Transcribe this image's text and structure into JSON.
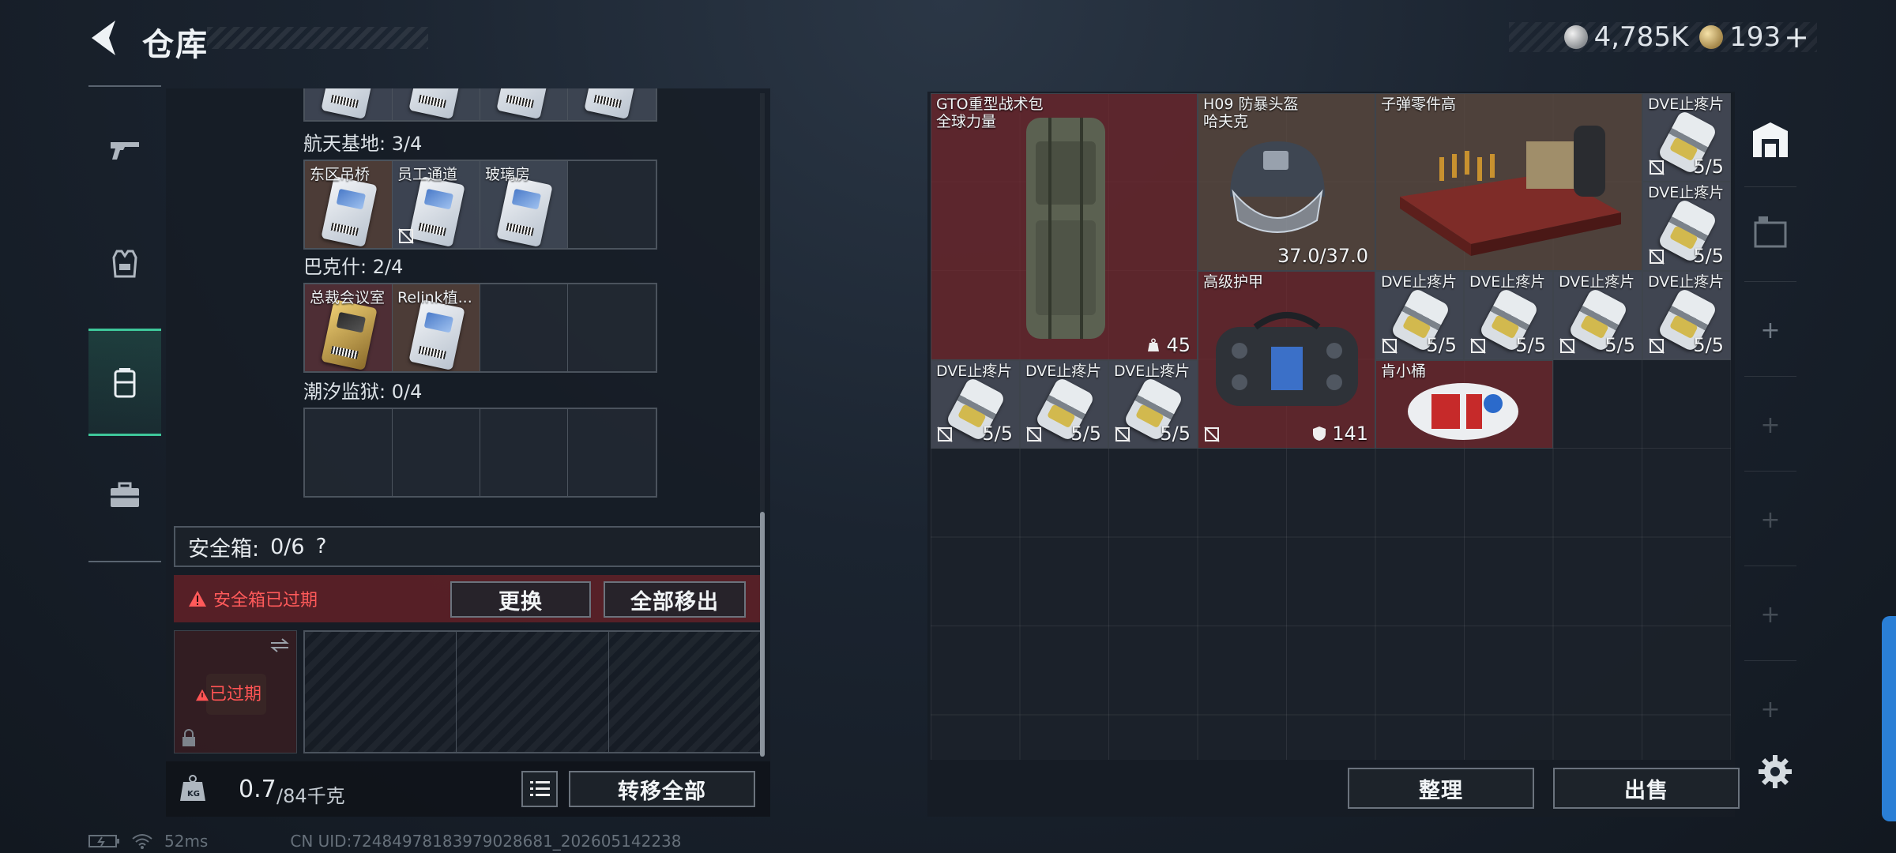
{
  "header": {
    "title": "仓库"
  },
  "currency": {
    "silver_amount": "4,785K",
    "gold_amount": "193",
    "plus": "+"
  },
  "left": {
    "sections": [
      {
        "label": "航天基地: 3/4",
        "cells": [
          "东区吊桥",
          "员工通道",
          "玻璃房",
          ""
        ]
      },
      {
        "label": "巴克什: 2/4",
        "cells": [
          "总裁会议室",
          "Relink植...",
          "",
          ""
        ]
      },
      {
        "label": "潮汐监狱: 0/4",
        "cells": [
          "",
          "",
          "",
          ""
        ]
      }
    ],
    "safe_box": {
      "label": "安全箱:",
      "count": "0/6",
      "help": "?"
    },
    "expired_warning": "安全箱已过期",
    "replace_button": "更换",
    "remove_all_button": "全部移出",
    "slot_expired": "已过期",
    "weight": {
      "current": "0.7",
      "max": "/84千克"
    },
    "transfer_all_button": "转移全部"
  },
  "stash": {
    "items": [
      {
        "name": "GTO重型战术包\n全球力量",
        "stat": "45",
        "icon": "backpack",
        "color": "#7a2a30"
      },
      {
        "name": "H09 防暴头盔\n哈夫克",
        "stat": "37.0/37.0",
        "icon": "helmet",
        "color": "#5c4a40"
      },
      {
        "name": "子弹零件高",
        "stat": "",
        "icon": "ammo-crate",
        "color": "#5c4a40"
      },
      {
        "name": "DVE止疼片",
        "stat": "5/5"
      },
      {
        "name": "DVE止疼片",
        "stat": "5/5"
      },
      {
        "name": "高级护甲",
        "stat": "141",
        "icon": "armor-bag",
        "color": "#7a2a30"
      },
      {
        "name": "DVE止疼片",
        "stat": "5/5"
      },
      {
        "name": "DVE止疼片",
        "stat": "5/5"
      },
      {
        "name": "DVE止疼片",
        "stat": "5/5"
      },
      {
        "name": "DVE止疼片",
        "stat": "5/5"
      },
      {
        "name": "DVE止疼片",
        "stat": "5/5"
      },
      {
        "name": "DVE止疼片",
        "stat": "5/5"
      },
      {
        "name": "DVE止疼片",
        "stat": "5/5"
      },
      {
        "name": "肯小桶",
        "stat": "",
        "icon": "kfc-bucket",
        "color": "#7a2a30"
      }
    ],
    "sort_button": "整理",
    "sell_button": "出售"
  },
  "status": {
    "ping": "52ms",
    "uid": "CN UID:7248497818397902868​1_202605142238"
  }
}
